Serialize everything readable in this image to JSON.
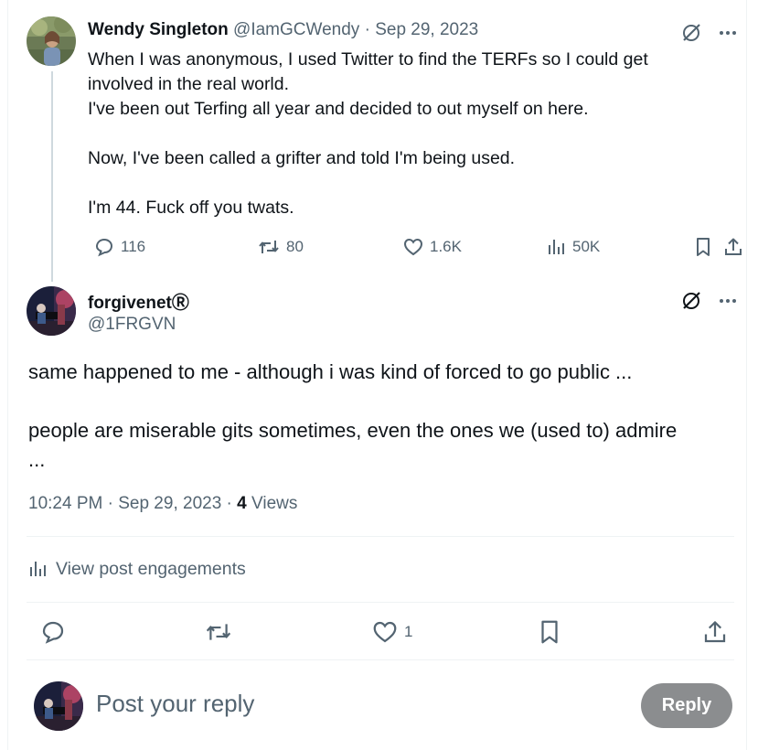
{
  "parent_tweet": {
    "author_name": "Wendy Singleton",
    "author_handle": "@IamGCWendy",
    "separator": "·",
    "date": "Sep 29, 2023",
    "lines": [
      "When I was anonymous, I used Twitter to find the TERFs so I could get",
      "involved in the real world.",
      "I've been out Terfing all year and decided to out myself on here.",
      "",
      "Now, I've been called a grifter and told I'm being used.",
      "",
      "I'm 44. Fuck off you twats."
    ],
    "stats": {
      "replies": "116",
      "reposts": "80",
      "likes": "1.6K",
      "views": "50K"
    }
  },
  "reply_tweet": {
    "author_name": "forgivenetⓇ",
    "author_handle": "@1FRGVN",
    "lines": [
      "same happened to me - although i was kind of forced to go public ...",
      "",
      "people are miserable gits sometimes, even the ones we (used to) admire",
      "..."
    ],
    "time": "10:24 PM",
    "separator": "·",
    "date": "Sep 29, 2023",
    "views_count": "4",
    "views_label": "Views",
    "engagements_label": "View post engagements",
    "likes": "1"
  },
  "compose": {
    "placeholder": "Post your reply",
    "reply_label": "Reply"
  },
  "colors": {
    "text": "#0f1419",
    "secondary": "#536471",
    "divider": "#eff3f4",
    "reply_button": "#8b8d8f"
  }
}
